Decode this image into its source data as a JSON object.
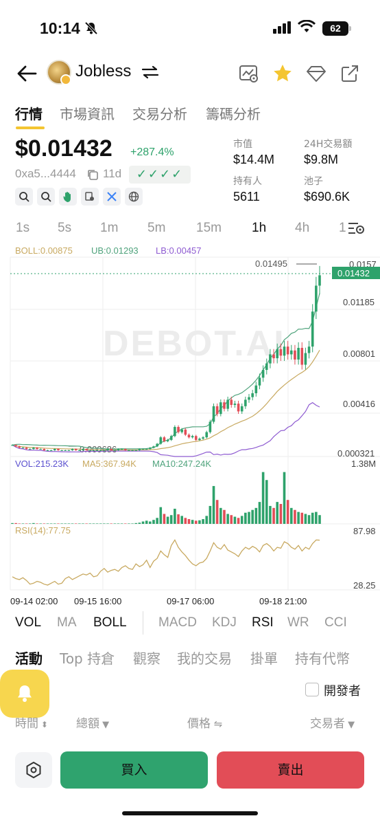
{
  "status_bar": {
    "time": "10:14",
    "battery": "62"
  },
  "header": {
    "token_name": "Jobless"
  },
  "tabs": [
    "行情",
    "市場資訊",
    "交易分析",
    "籌碼分析"
  ],
  "price": {
    "value": "$0.01432",
    "change": "+287.4%",
    "address": "0xa5...4444",
    "age": "11d",
    "checks": "✓✓✓✓"
  },
  "stats": {
    "market_cap_label": "市值",
    "market_cap": "$14.4M",
    "volume_label": "24H交易額",
    "volume": "$9.8M",
    "holders_label": "持有人",
    "holders": "5611",
    "pool_label": "池子",
    "pool": "$690.6K"
  },
  "timeframes": [
    "1s",
    "5s",
    "1m",
    "5m",
    "15m",
    "1h",
    "4h",
    "1"
  ],
  "active_timeframe": "1h",
  "chart_data": {
    "type": "candlestick",
    "watermark": "DEBOT.AI",
    "boll": {
      "label": "BOLL:0.00875",
      "ub": "UB:0.01293",
      "lb": "LB:0.00457"
    },
    "price_axis": [
      "0.0157",
      "0.01185",
      "0.00801",
      "0.00416",
      "0.000321"
    ],
    "current_price_tag": "0.01432",
    "high_label": "0.01495",
    "low_label": "0.000686",
    "volume": {
      "label": "VOL:215.23K",
      "ma5": "MA5:367.94K",
      "ma10": "MA10:247.24K",
      "max": "1.38M"
    },
    "rsi": {
      "label": "RSI(14):77.75",
      "max": "87.98",
      "min": "28.25"
    },
    "x_labels": [
      "09-14 02:00",
      "09-15 16:00",
      "09-17 06:00",
      "09-18 21:00"
    ],
    "close_prices": [
      0.0012,
      0.0011,
      0.001,
      0.001,
      0.0009,
      0.0009,
      0.001,
      0.0009,
      0.0009,
      0.0008,
      0.0008,
      0.0008,
      0.0009,
      0.0008,
      0.0008,
      0.0008,
      0.0008,
      0.0009,
      0.0008,
      0.0008,
      0.0009,
      0.0008,
      0.0008,
      0.0008,
      0.0008,
      0.0008,
      0.0008,
      0.0009,
      0.0008,
      0.0008,
      0.0009,
      0.0009,
      0.0008,
      0.0008,
      0.0008,
      0.0008,
      0.0009,
      0.0009,
      0.0009,
      0.001,
      0.0011,
      0.0013,
      0.0018,
      0.0015,
      0.0016,
      0.0019,
      0.0026,
      0.0022,
      0.0024,
      0.002,
      0.0018,
      0.0019,
      0.0016,
      0.0017,
      0.0018,
      0.0022,
      0.003,
      0.0042,
      0.0036,
      0.0045,
      0.004,
      0.0047,
      0.0043,
      0.0044,
      0.0038,
      0.0042,
      0.0047,
      0.0049,
      0.0052,
      0.0058,
      0.0064,
      0.007,
      0.0075,
      0.0082,
      0.0079,
      0.0086,
      0.0081,
      0.0088,
      0.0082,
      0.0085,
      0.0078,
      0.0087,
      0.0074,
      0.0083,
      0.0088,
      0.0115,
      0.0135,
      0.0143
    ],
    "volumes": [
      0.02,
      0.02,
      0.01,
      0.01,
      0.01,
      0.01,
      0.02,
      0.01,
      0.01,
      0.01,
      0.01,
      0.01,
      0.01,
      0.01,
      0.01,
      0.01,
      0.01,
      0.01,
      0.01,
      0.01,
      0.01,
      0.01,
      0.01,
      0.01,
      0.01,
      0.01,
      0.01,
      0.01,
      0.01,
      0.01,
      0.01,
      0.01,
      0.01,
      0.01,
      0.01,
      0.02,
      0.03,
      0.06,
      0.08,
      0.06,
      0.1,
      0.15,
      0.42,
      0.25,
      0.18,
      0.22,
      0.38,
      0.24,
      0.2,
      0.15,
      0.12,
      0.1,
      0.08,
      0.09,
      0.12,
      0.2,
      0.45,
      0.95,
      0.6,
      0.4,
      0.35,
      0.25,
      0.22,
      0.18,
      0.15,
      0.2,
      0.28,
      0.3,
      0.35,
      0.4,
      0.55,
      1.3,
      1.1,
      0.45,
      0.4,
      0.55,
      0.5,
      1.3,
      0.6,
      0.4,
      0.35,
      0.3,
      0.28,
      0.25,
      0.22,
      0.28,
      0.3,
      0.22
    ],
    "rsi_values": [
      38,
      36,
      35,
      37,
      34,
      30,
      31,
      33,
      32,
      30,
      29,
      31,
      33,
      30,
      31,
      36,
      38,
      35,
      37,
      39,
      41,
      40,
      42,
      38,
      39,
      44,
      47,
      43,
      45,
      46,
      44,
      48,
      50,
      47,
      46,
      52,
      49,
      51,
      56,
      48,
      55,
      58,
      66,
      62,
      59,
      72,
      78,
      70,
      65,
      61,
      56,
      52,
      50,
      53,
      54,
      58,
      66,
      75,
      70,
      68,
      73,
      67,
      65,
      63,
      60,
      66,
      70,
      68,
      71,
      69,
      65,
      72,
      74,
      71,
      66,
      70,
      69,
      76,
      74,
      70,
      68,
      72,
      66,
      70,
      68,
      74,
      78,
      77.75
    ]
  },
  "indicators_main": [
    "VOL",
    "MA",
    "BOLL"
  ],
  "indicators_sub": [
    "MACD",
    "KDJ",
    "RSI",
    "WR",
    "CCI"
  ],
  "active_indicators": [
    "VOL",
    "BOLL",
    "RSI"
  ],
  "activity_tabs": [
    "活動",
    "Top 持倉",
    "觀察",
    "我的交易",
    "掛單",
    "持有代幣"
  ],
  "developer_filter_label": "開發者",
  "table_headers": [
    "時間",
    "總額",
    "價格",
    "交易者"
  ],
  "actions": {
    "buy": "買入",
    "sell": "賣出"
  },
  "colors": {
    "up": "#2ea26b",
    "down": "#e24d57",
    "accent": "#f4c531"
  }
}
